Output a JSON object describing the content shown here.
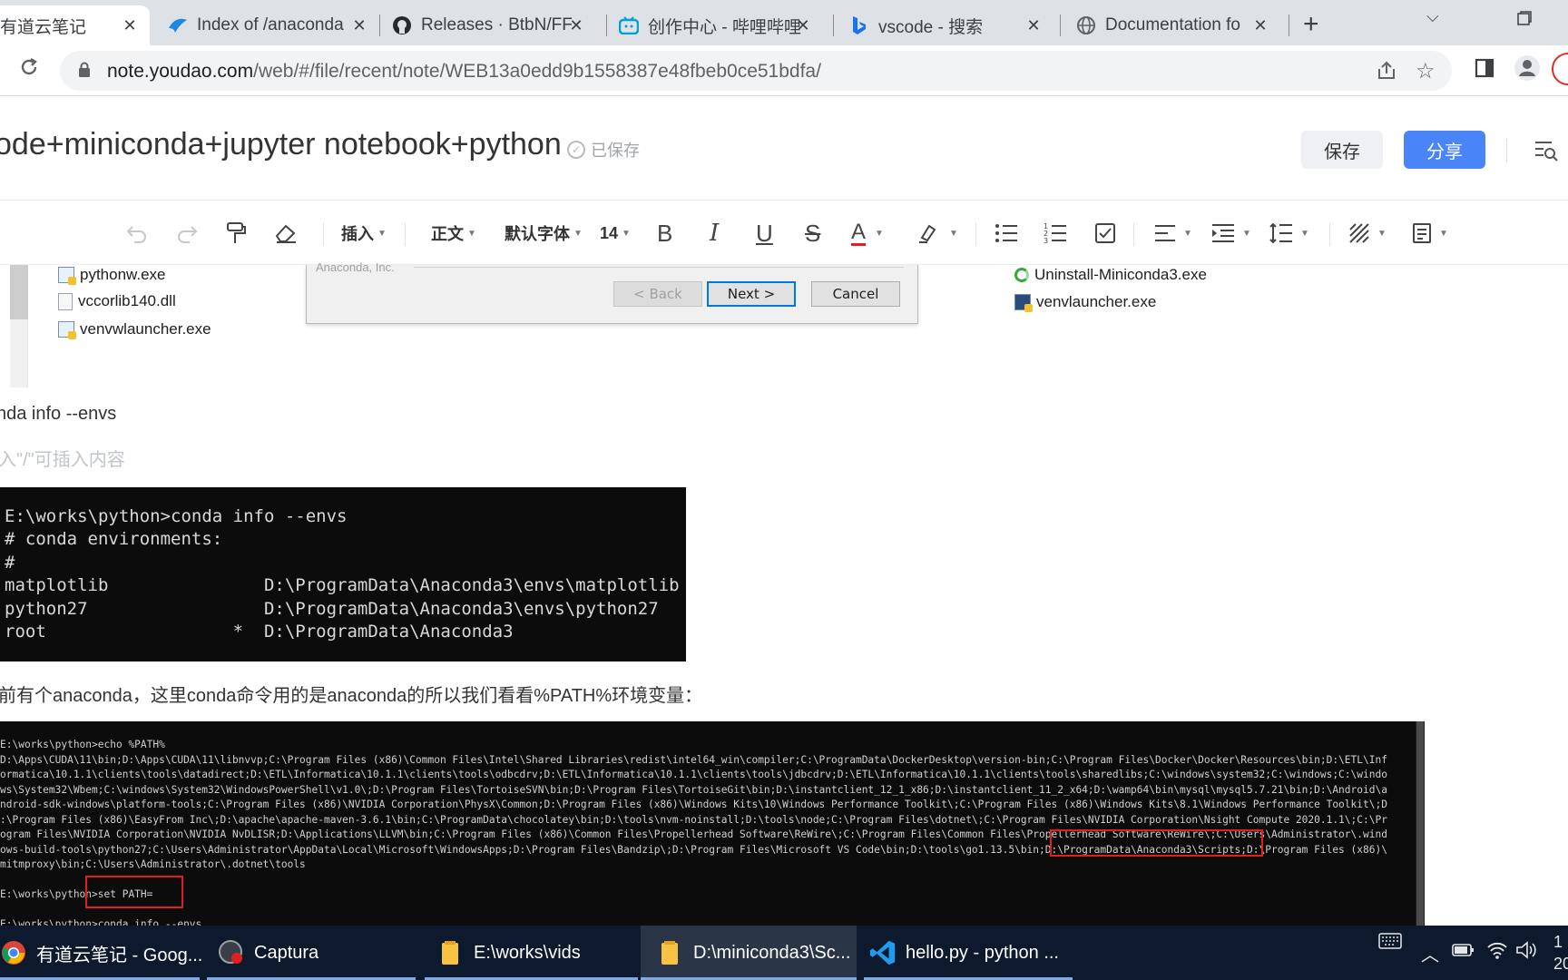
{
  "browser": {
    "tabs": [
      {
        "title": "有道云笔记",
        "icon": "youdao-icon",
        "active": true
      },
      {
        "title": "Index of /anaconda",
        "icon": "tuna-icon"
      },
      {
        "title": "Releases · BtbN/FF",
        "icon": "github-icon"
      },
      {
        "title": "创作中心 - 哔哩哔哩",
        "icon": "bilibili-icon"
      },
      {
        "title": "vscode - 搜索",
        "icon": "bing-icon"
      },
      {
        "title": "Documentation fo",
        "icon": "globe-icon"
      }
    ],
    "new_tab": "+",
    "url_host": "note.youdao.com",
    "url_path": "/web/#/file/recent/note/WEB13a0edd9b1558387e48fbeb0ce51bdfa/"
  },
  "note": {
    "title": "ode+miniconda+jupyter notebook+python",
    "saved_status": "已保存",
    "save_label": "保存",
    "share_label": "分享"
  },
  "editor_toolbar": {
    "insert": "插入",
    "paragraph": "正文",
    "font": "默认字体",
    "size": "14",
    "bold": "B",
    "italic": "I",
    "underline": "U",
    "strike": "S",
    "font_color": "A"
  },
  "installer": {
    "brand": "Anaconda, Inc.",
    "back": "< Back",
    "next": "Next >",
    "cancel": "Cancel",
    "left_files": [
      "pythonw.exe",
      "vccorlib140.dll",
      "venvwlauncher.exe"
    ],
    "right_files": [
      "Uninstall-Miniconda3.exe",
      "venvlauncher.exe"
    ]
  },
  "body": {
    "line1": "nda info --envs",
    "placeholder": "入\"/\"可插入内容",
    "line2": "前有个anaconda，这里conda命令用的是anaconda的所以我们看看%PATH%环境变量："
  },
  "terminal1": [
    "E:\\works\\python>conda info --envs",
    "# conda environments:",
    "#",
    "matplotlib               D:\\ProgramData\\Anaconda3\\envs\\matplotlib",
    "python27                 D:\\ProgramData\\Anaconda3\\envs\\python27",
    "root                  *  D:\\ProgramData\\Anaconda3"
  ],
  "terminal2": [
    "E:\\works\\python>echo %PATH%",
    "D:\\Apps\\CUDA\\11\\bin;D:\\Apps\\CUDA\\11\\libnvvp;C:\\Program Files (x86)\\Common Files\\Intel\\Shared Libraries\\redist\\intel64_win\\compiler;C:\\ProgramData\\DockerDesktop\\version-bin;C:\\Program Files\\Docker\\Docker\\Resources\\bin;D:\\ETL\\Inf",
    "ormatica\\10.1.1\\clients\\tools\\datadirect;D:\\ETL\\Informatica\\10.1.1\\clients\\tools\\odbcdrv;D:\\ETL\\Informatica\\10.1.1\\clients\\tools\\jdbcdrv;D:\\ETL\\Informatica\\10.1.1\\clients\\tools\\sharedlibs;C:\\windows\\system32;C:\\windows;C:\\windo",
    "ws\\System32\\Wbem;C:\\windows\\System32\\WindowsPowerShell\\v1.0\\;D:\\Program Files\\TortoiseSVN\\bin;D:\\Program Files\\TortoiseGit\\bin;D:\\instantclient_12_1_x86;D:\\instantclient_11_2_x64;D:\\wamp64\\bin\\mysql\\mysql5.7.21\\bin;D:\\Android\\a",
    "ndroid-sdk-windows\\platform-tools;C:\\Program Files (x86)\\NVIDIA Corporation\\PhysX\\Common;D:\\Program Files (x86)\\Windows Kits\\10\\Windows Performance Toolkit\\;C:\\Program Files (x86)\\Windows Kits\\8.1\\Windows Performance Toolkit\\;D",
    ":\\Program Files (x86)\\EasyFrom Inc\\;D:\\apache\\apache-maven-3.6.1\\bin;C:\\ProgramData\\chocolatey\\bin;D:\\tools\\nvm-noinstall;D:\\tools\\node;C:\\Program Files\\dotnet\\;C:\\Program Files\\NVIDIA Corporation\\Nsight Compute 2020.1.1\\;C:\\Pr",
    "ogram Files\\NVIDIA Corporation\\NVIDIA NvDLISR;D:\\Applications\\LLVM\\bin;C:\\Program Files (x86)\\Common Files\\Propellerhead Software\\ReWire\\;C:\\Program Files\\Common Files\\Propellerhead Software\\ReWire\\;C:\\Users\\Administrator\\.wind",
    "ows-build-tools\\python27;C:\\Users\\Administrator\\AppData\\Local\\Microsoft\\WindowsApps;D:\\Program Files\\Bandzip\\;D:\\Program Files\\Microsoft VS Code\\bin;D:\\tools\\go1.13.5\\bin;D:\\ProgramData\\Anaconda3\\Scripts;D:\\Program Files (x86)\\",
    "mitmproxy\\bin;C:\\Users\\Administrator\\.dotnet\\tools",
    "",
    "E:\\works\\python>set PATH=",
    "",
    "E:\\works\\python>conda info --envs"
  ],
  "taskbar": [
    {
      "label": "有道云笔记 - Goog...",
      "icon": "chrome-icon"
    },
    {
      "label": "Captura",
      "icon": "captura-icon"
    },
    {
      "label": "E:\\works\\vids",
      "icon": "folder-icon"
    },
    {
      "label": "D:\\miniconda3\\Sc...",
      "icon": "folder-icon",
      "active": true
    },
    {
      "label": "hello.py - python ...",
      "icon": "vscode-icon"
    }
  ],
  "clock": {
    "line1": "1",
    "line2": "20"
  },
  "colors": {
    "share_blue": "#4a85f7",
    "highlight_red": "#e02020",
    "taskbar": "#0d1a2e"
  }
}
